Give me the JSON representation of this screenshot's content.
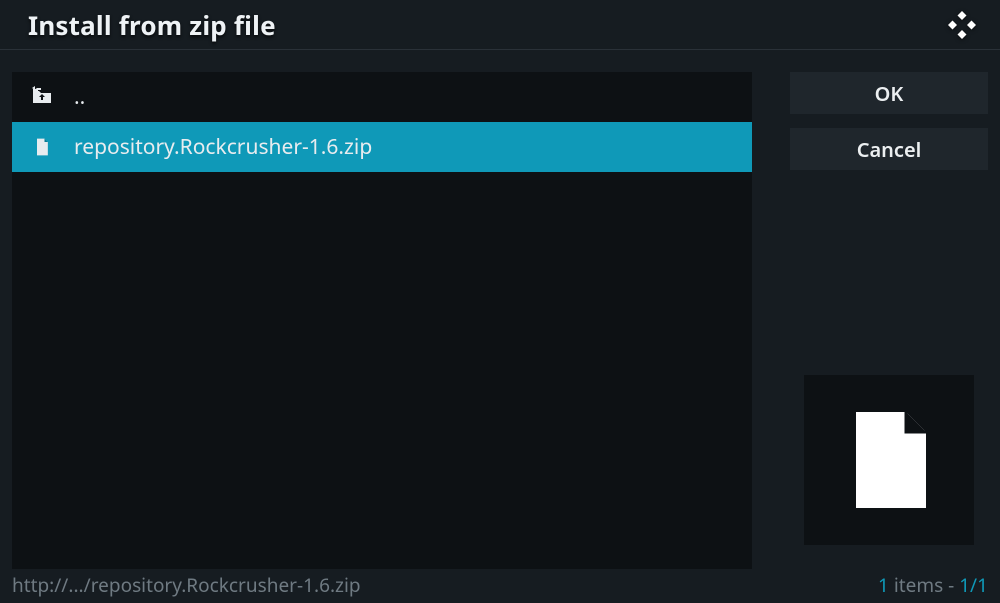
{
  "header": {
    "title": "Install from zip file"
  },
  "list": {
    "items": [
      {
        "name": "parent-dir",
        "label": "..",
        "icon": "folder-up",
        "selected": false
      },
      {
        "name": "file-zip",
        "label": "repository.Rockcrusher-1.6.zip",
        "icon": "file",
        "selected": true
      }
    ]
  },
  "buttons": {
    "ok": "OK",
    "cancel": "Cancel"
  },
  "status": {
    "path": "http://.../repository.Rockcrusher-1.6.zip",
    "count_prefix": "1",
    "count_mid": " items - ",
    "count_suffix": "1/1"
  }
}
